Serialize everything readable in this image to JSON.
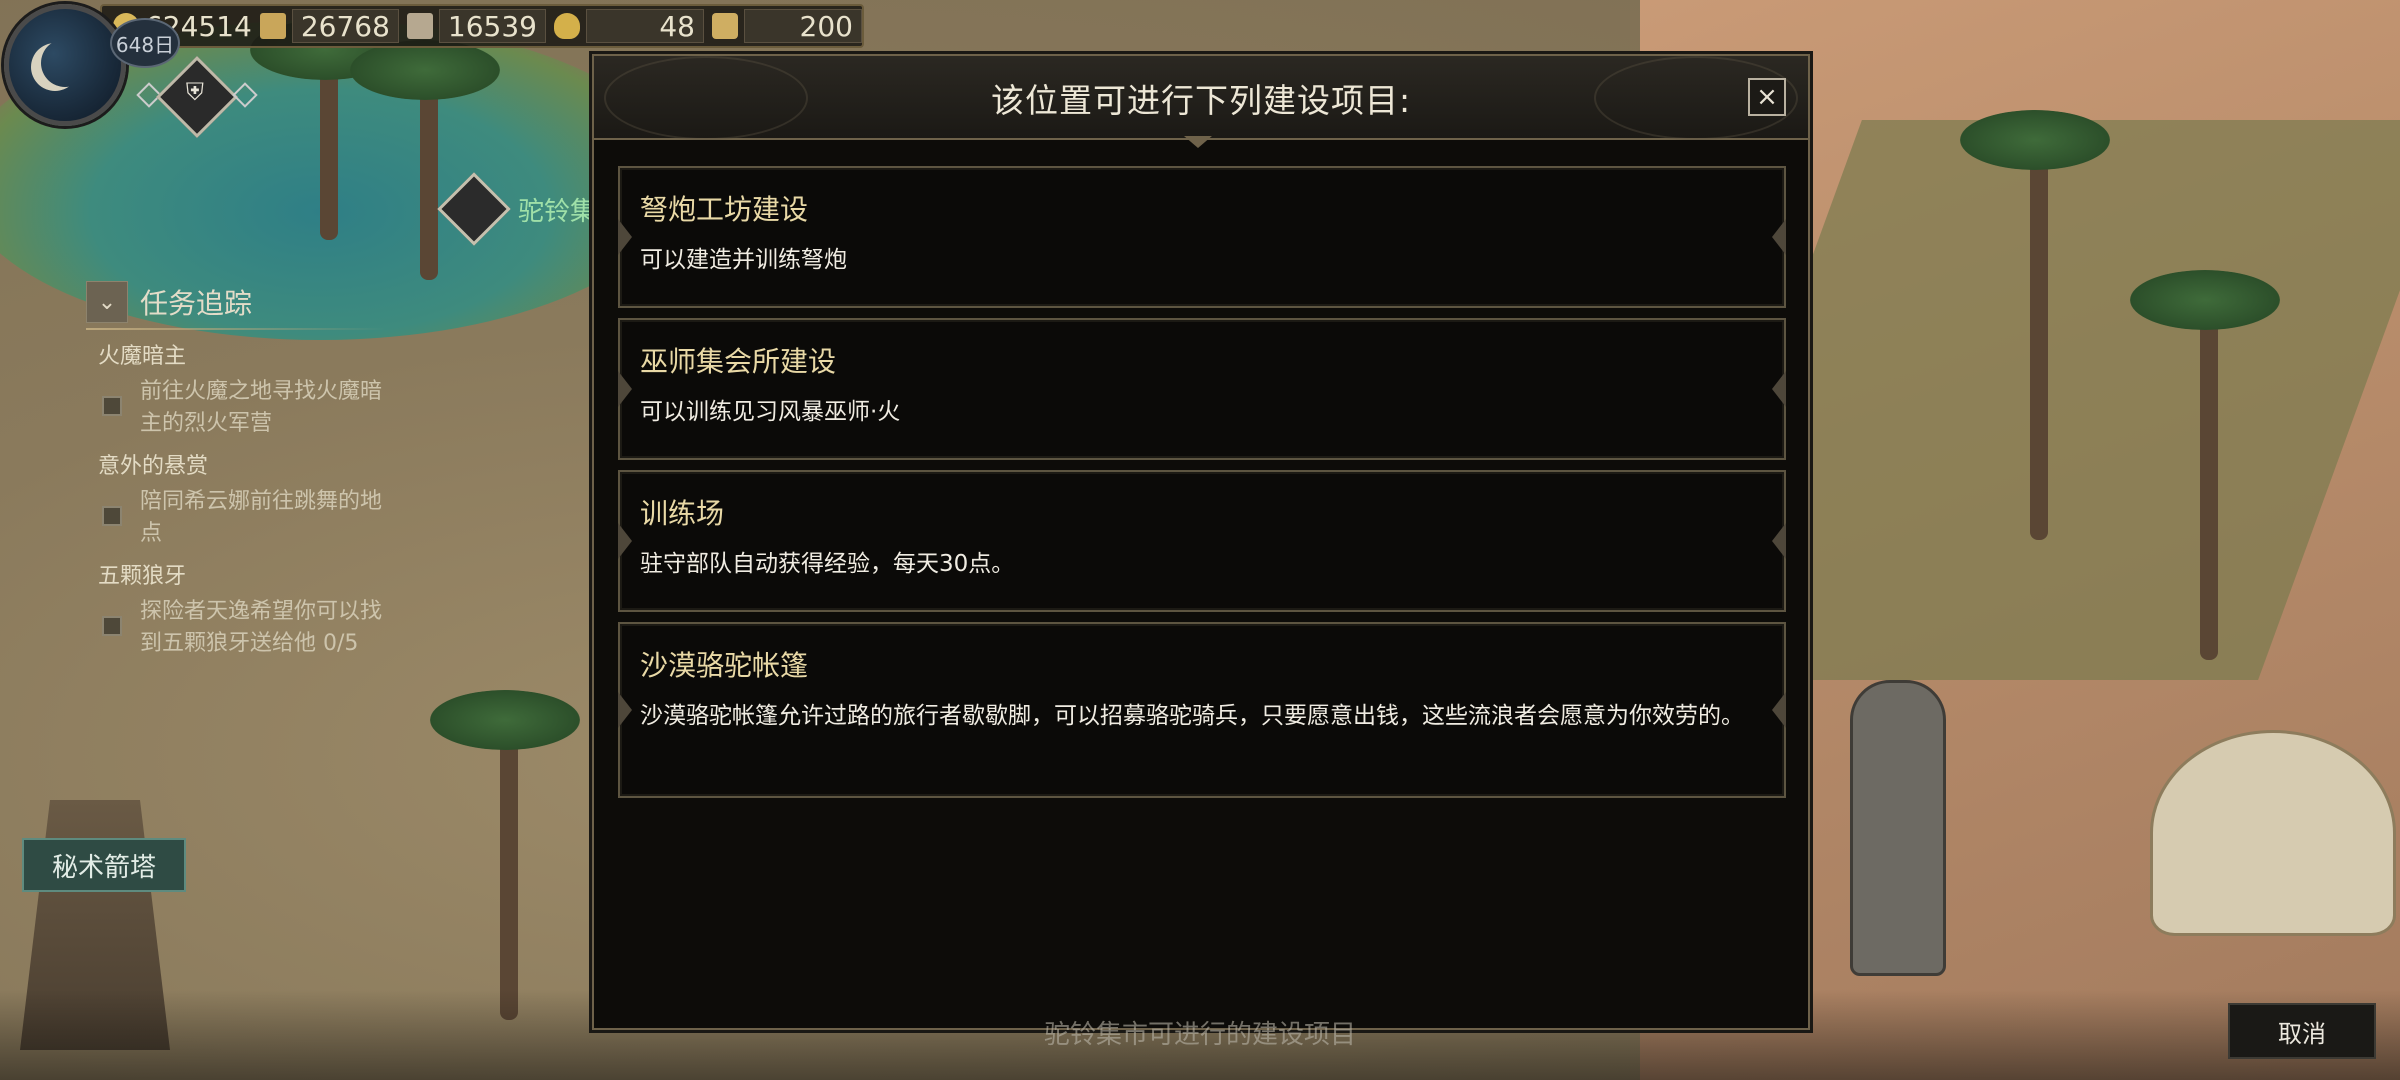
{
  "hud": {
    "day": "648日",
    "resources": [
      {
        "icon": "coin-icon",
        "value": "624514"
      },
      {
        "icon": "wood-icon",
        "value": "26768"
      },
      {
        "icon": "stone-icon",
        "value": "16539"
      },
      {
        "icon": "food-icon",
        "value": "48"
      },
      {
        "icon": "scroll-icon",
        "value": "200"
      }
    ]
  },
  "location": {
    "name": "驼铃集"
  },
  "quest_tracker": {
    "title": "任务追踪",
    "quests": [
      {
        "category": "火魔暗主",
        "text": "前往火魔之地寻找火魔暗主的烈火军营"
      },
      {
        "category": "意外的悬赏",
        "text": "陪同希云娜前往跳舞的地点"
      },
      {
        "category": "五颗狼牙",
        "text": "探险者天逸希望你可以找到五颗狼牙送给他 0/5"
      }
    ]
  },
  "map_labels": {
    "tower": "秘术箭塔"
  },
  "modal": {
    "title": "该位置可进行下列建设项目:",
    "close": "×",
    "options": [
      {
        "name": "弩炮工坊建设",
        "desc": "可以建造并训练弩炮"
      },
      {
        "name": "巫师集会所建设",
        "desc": "可以训练见习风暴巫师·火"
      },
      {
        "name": "训练场",
        "desc": "驻守部队自动获得经验，每天30点。"
      },
      {
        "name": "沙漠骆驼帐篷",
        "desc": "沙漠骆驼帐篷允许过路的旅行者歇歇脚，可以招募骆驼骑兵，只要愿意出钱，这些流浪者会愿意为你效劳的。"
      }
    ]
  },
  "footer": {
    "hint": "驼铃集市可进行的建设项目",
    "cancel": "取消"
  },
  "colors": {
    "modal_bg": "#0d0c09",
    "option_title": "#e9d9a6",
    "border": "#6e624a"
  }
}
